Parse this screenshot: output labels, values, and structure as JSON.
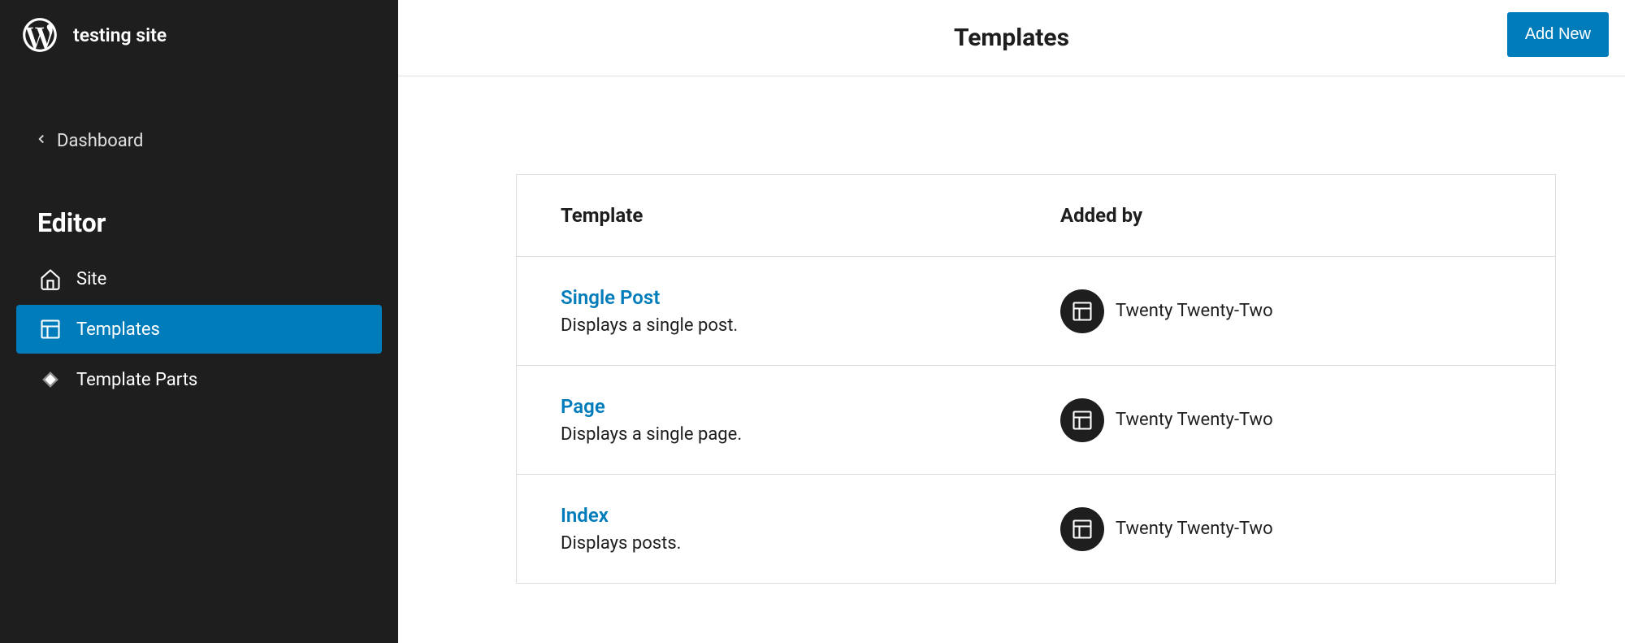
{
  "site_name": "testing site",
  "back_label": "Dashboard",
  "editor_title": "Editor",
  "nav": [
    {
      "label": "Site",
      "icon": "home-icon",
      "active": false
    },
    {
      "label": "Templates",
      "icon": "layout-icon",
      "active": true
    },
    {
      "label": "Template Parts",
      "icon": "diamond-icon",
      "active": false
    }
  ],
  "page_title": "Templates",
  "add_new_label": "Add New",
  "table": {
    "headers": {
      "template": "Template",
      "added_by": "Added by"
    },
    "rows": [
      {
        "name": "Single Post",
        "desc": "Displays a single post.",
        "added_by": "Twenty Twenty-Two"
      },
      {
        "name": "Page",
        "desc": "Displays a single page.",
        "added_by": "Twenty Twenty-Two"
      },
      {
        "name": "Index",
        "desc": "Displays posts.",
        "added_by": "Twenty Twenty-Two"
      }
    ]
  }
}
